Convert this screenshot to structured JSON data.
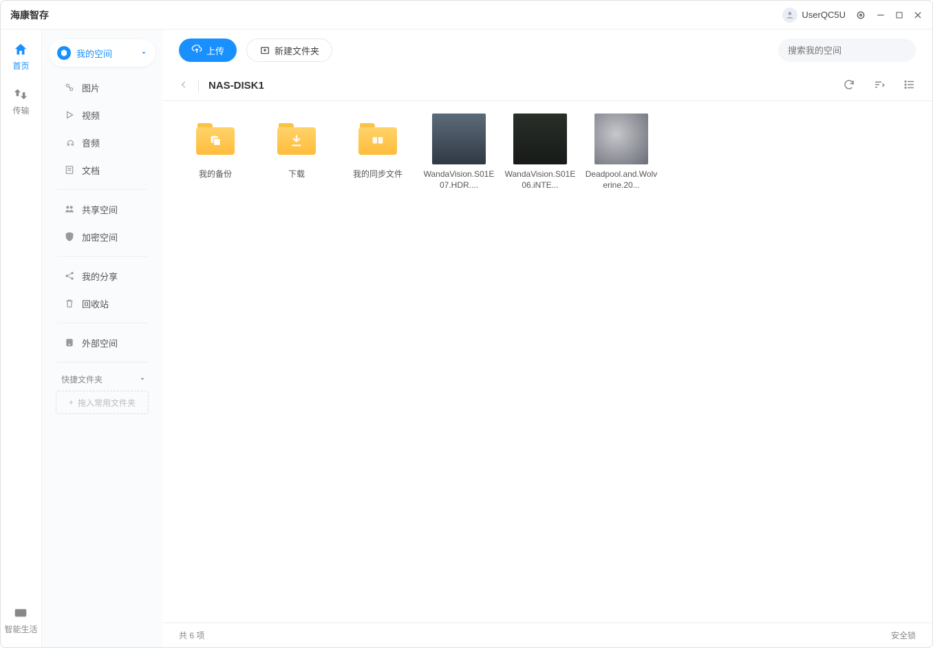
{
  "app_title": "海康智存",
  "user": {
    "name": "UserQC5U"
  },
  "rail": {
    "home": "首页",
    "transfer": "传输",
    "smartlife": "智能生活"
  },
  "sidebar": {
    "space_selector": "我的空间",
    "tabs": {
      "pic": "图片",
      "video": "视频",
      "audio": "音频",
      "doc": "文档"
    },
    "shared": "共享空间",
    "secure": "加密空间",
    "myshare": "我的分享",
    "recycle": "回收站",
    "external": "外部空间",
    "quick_header": "快捷文件夹",
    "quick_hint": "拖入常用文件夹"
  },
  "toolbar": {
    "upload": "上传",
    "newfolder": "新建文件夹",
    "search_placeholder": "搜索我的空间"
  },
  "breadcrumb": {
    "current": "NAS-DISK1"
  },
  "items": [
    {
      "type": "folder",
      "glyph": "copy",
      "name": "我的备份"
    },
    {
      "type": "folder",
      "glyph": "down",
      "name": "下载"
    },
    {
      "type": "folder",
      "glyph": "sync",
      "name": "我的同步文件"
    },
    {
      "type": "video",
      "variant": "v1",
      "name": "WandaVision.S01E07.HDR...."
    },
    {
      "type": "video",
      "variant": "v2",
      "name": "WandaVision.S01E06.iNTE..."
    },
    {
      "type": "video",
      "variant": "v3",
      "name": "Deadpool.and.Wolverine.20..."
    }
  ],
  "status": {
    "count": "共 6 项",
    "lock": "安全锁"
  }
}
